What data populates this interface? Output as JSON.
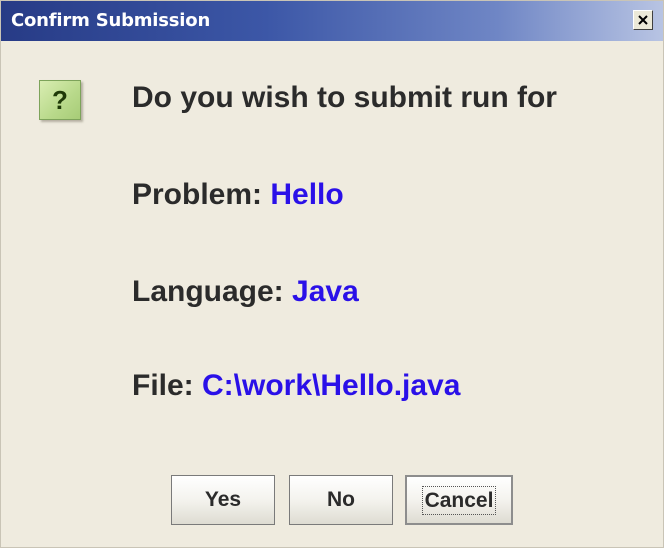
{
  "window": {
    "title": "Confirm Submission",
    "close_label": "×"
  },
  "icons": {
    "question": "question-icon",
    "close": "close-icon"
  },
  "message": {
    "question": "Do you wish to submit run for",
    "problem_label": "Problem:",
    "problem_value": "Hello",
    "language_label": "Language:",
    "language_value": "Java",
    "file_label": "File:",
    "file_value": "C:\\work\\Hello.java",
    "question_mark": "?"
  },
  "buttons": {
    "yes": "Yes",
    "no": "No",
    "cancel": "Cancel"
  },
  "colors": {
    "value_text": "#2a10e8",
    "body_background": "#efebdf",
    "title_gradient_start": "#273b86"
  }
}
